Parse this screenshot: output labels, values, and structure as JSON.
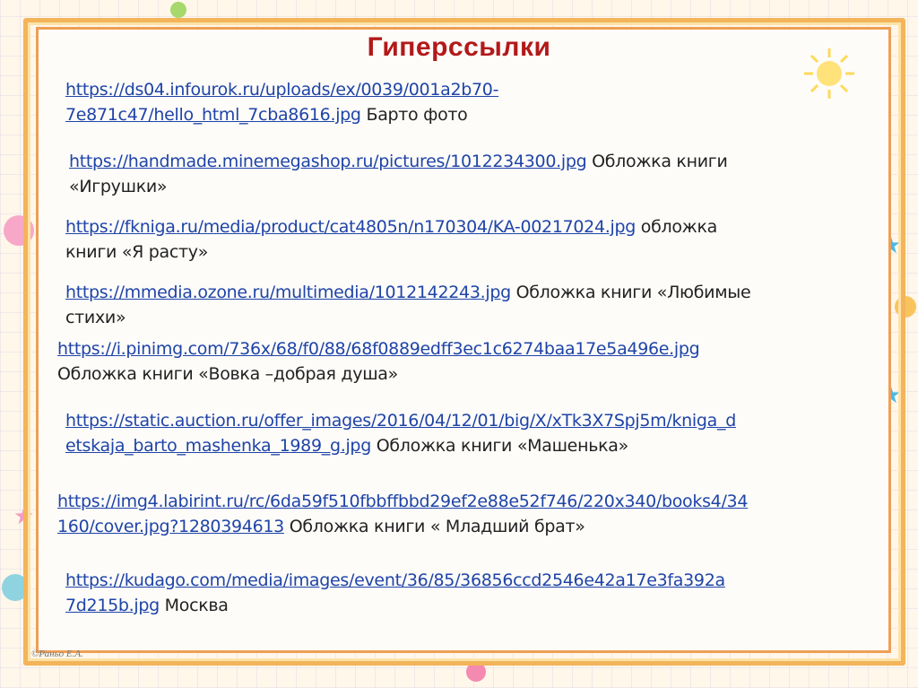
{
  "slide": {
    "title": "Гиперссылки",
    "copyright": "©Раньо Е.А.",
    "links": [
      {
        "url": "https://ds04.infourok.ru/uploads/ex/0039/001a2b70-7e871c47/hello_html_7cba8616.jpg",
        "url_line1": "https://ds04.infourok.ru/uploads/ex/0039/001a2b70-",
        "url_line2": "7e871c47/hello_html_7cba8616.jpg",
        "caption": "Барто фото"
      },
      {
        "url_line1": "https://handmade.minemegashop.ru/pictures/1012234300.jpg",
        "caption1": "Обложка книги",
        "caption2": "«Игрушки»"
      },
      {
        "url_line1": "https://fkniga.ru/media/product/cat4805n/n170304/KA-00217024.jpg",
        "caption1": "обложка",
        "caption2": "книги «Я расту»"
      },
      {
        "url_line1": "https://mmedia.ozone.ru/multimedia/1012142243.jpg",
        "caption1": "Обложка книги «Любимые",
        "caption2": "стихи»"
      },
      {
        "url_line1": "https://i.pinimg.com/736x/68/f0/88/68f0889edff3ec1c6274baa17e5a496e.jpg",
        "caption2": "Обложка книги «Вовка –добрая душа»"
      },
      {
        "url_line1": "https://static.auction.ru/offer_images/2016/04/12/01/big/X/xTk3X7Spj5m/kniga_d",
        "url_line2": "etskaja_barto_mashenka_1989_g.jpg",
        "caption": "Обложка книги «Машенька»"
      },
      {
        "url_line1": "https://img4.labirint.ru/rc/6da59f510fbbffbbd29ef2e88e52f746/220x340/books4/34",
        "url_line2": "160/cover.jpg?1280394613",
        "caption": "Обложка  книги « Младший брат»"
      },
      {
        "url_line1": "https://kudago.com/media/images/event/36/85/36856ccd2546e42a17e3fa392a",
        "url_line2": "7d215b.jpg",
        "caption": "Москва"
      }
    ]
  }
}
